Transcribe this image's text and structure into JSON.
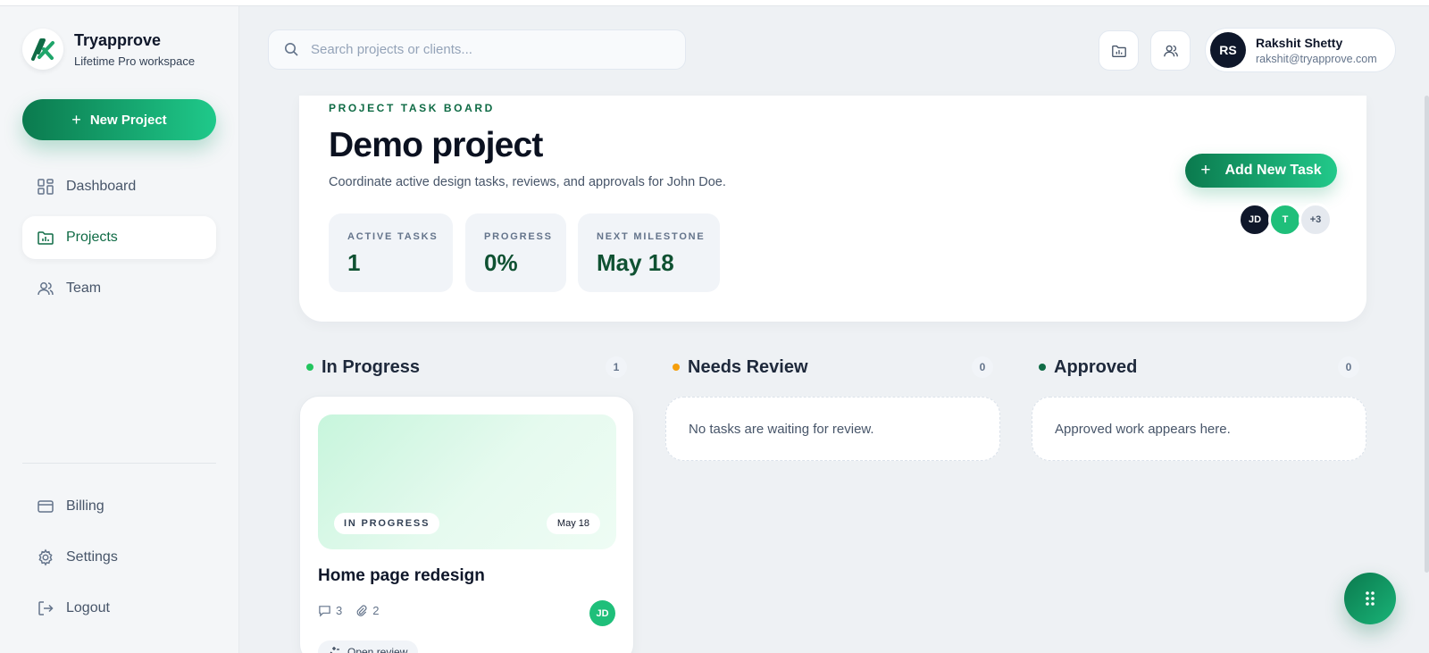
{
  "brand": {
    "name": "Tryapprove",
    "subtitle": "Lifetime Pro workspace"
  },
  "sidebar": {
    "new_project_label": "New Project",
    "nav": [
      {
        "label": "Dashboard",
        "icon": "dashboard-icon",
        "active": false
      },
      {
        "label": "Projects",
        "icon": "folder-chart-icon",
        "active": true
      },
      {
        "label": "Team",
        "icon": "users-icon",
        "active": false
      }
    ],
    "bottom_nav": [
      {
        "label": "Billing",
        "icon": "credit-card-icon"
      },
      {
        "label": "Settings",
        "icon": "gear-icon"
      },
      {
        "label": "Logout",
        "icon": "logout-icon"
      }
    ]
  },
  "header": {
    "search_placeholder": "Search projects or clients...",
    "user": {
      "initials": "RS",
      "name": "Rakshit Shetty",
      "email": "rakshit@tryapprove.com"
    }
  },
  "project": {
    "eyebrow": "PROJECT TASK BOARD",
    "title": "Demo project",
    "description": "Coordinate active design tasks, reviews, and approvals for John Doe.",
    "stats": [
      {
        "label": "ACTIVE TASKS",
        "value": "1"
      },
      {
        "label": "PROGRESS",
        "value": "0%"
      },
      {
        "label": "NEXT MILESTONE",
        "value": "May 18"
      }
    ],
    "add_task_label": "Add New Task",
    "team": [
      {
        "initials": "JD",
        "bg": "#0f172a",
        "fg": "#ffffff"
      },
      {
        "initials": "T",
        "bg": "#1fbf7a",
        "fg": "#ffffff"
      },
      {
        "initials": "+3",
        "bg": "#e5e9ef",
        "fg": "#475569"
      }
    ]
  },
  "columns": [
    {
      "title": "In Progress",
      "count": "1",
      "dot_color": "#22c55e"
    },
    {
      "title": "Needs Review",
      "count": "0",
      "dot_color": "#f59e0b",
      "empty_text": "No tasks are waiting for review."
    },
    {
      "title": "Approved",
      "count": "0",
      "dot_color": "#0f6b45",
      "empty_text": "Approved work appears here."
    }
  ],
  "task": {
    "status": "IN PROGRESS",
    "date": "May 18",
    "title": "Home page redesign",
    "comments": "3",
    "attachments": "2",
    "assignee": "JD",
    "action_label": "Open review"
  },
  "colors": {
    "accent": "#0f6b45",
    "accent_light": "#1fc98a"
  }
}
